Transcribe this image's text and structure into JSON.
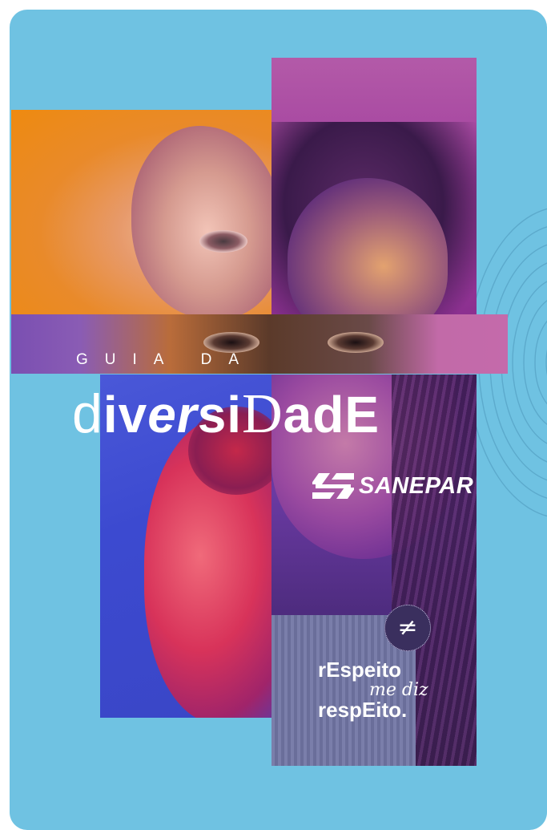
{
  "cover": {
    "kicker": "GUIA DA",
    "title_parts": [
      "d",
      "iv",
      "er",
      "si",
      "D",
      "ad",
      "E"
    ],
    "brand": "SANEPAR",
    "seal_symbol": "≠",
    "slogan": {
      "line1": "rEspeito",
      "line2": "me diz",
      "line3": "respEito."
    },
    "colors": {
      "background": "#6fc2e2",
      "orange": "#ee8a10",
      "purple": "#a23f9e",
      "blue": "#3c4ad0",
      "text": "#ffffff"
    },
    "icons": [
      "fingerprint-icon",
      "sanepar-logo-icon",
      "not-equal-seal-icon"
    ]
  }
}
